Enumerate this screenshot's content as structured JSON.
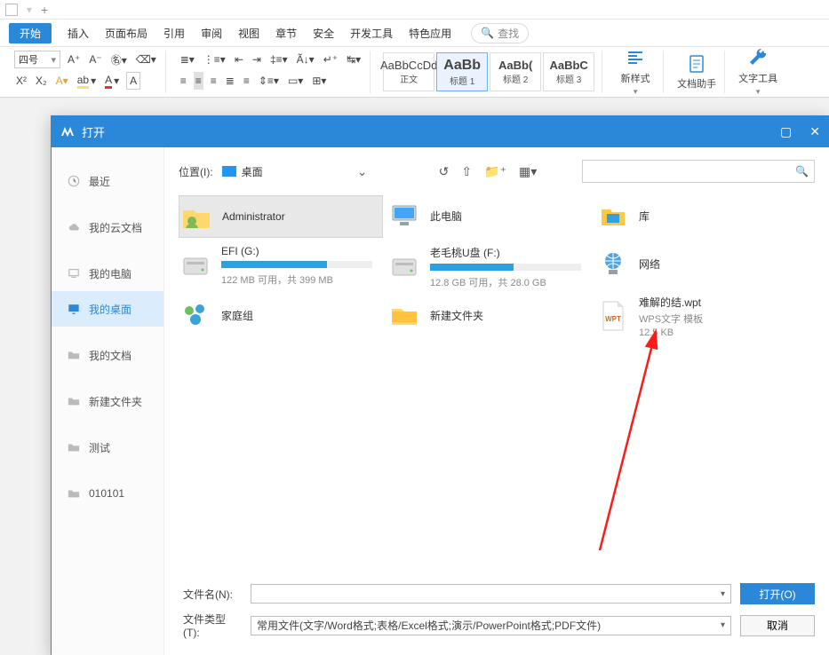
{
  "menu": {
    "start": "开始",
    "items": [
      "插入",
      "页面布局",
      "引用",
      "审阅",
      "视图",
      "章节",
      "安全",
      "开发工具",
      "特色应用"
    ],
    "search_label": "查找"
  },
  "ribbon": {
    "font_size": "四号",
    "styles": [
      {
        "preview": "AaBbCcDd",
        "label": "正文"
      },
      {
        "preview": "AaBb",
        "label": "标题 1"
      },
      {
        "preview": "AaBb(",
        "label": "标题 2"
      },
      {
        "preview": "AaBbC",
        "label": "标题 3"
      }
    ],
    "new_style": "新样式",
    "doc_assistant": "文档助手",
    "text_tools": "文字工具"
  },
  "dialog": {
    "title": "打开",
    "location_label": "位置(I):",
    "location_value": "桌面",
    "sidebar": [
      {
        "label": "最近",
        "icon": "clock"
      },
      {
        "label": "我的云文档",
        "icon": "cloud"
      },
      {
        "label": "我的电脑",
        "icon": "pc"
      },
      {
        "label": "我的桌面",
        "icon": "desktop",
        "active": true
      },
      {
        "label": "我的文档",
        "icon": "folder"
      },
      {
        "label": "新建文件夹",
        "icon": "folder"
      },
      {
        "label": "测试",
        "icon": "folder"
      },
      {
        "label": "010101",
        "icon": "folder"
      }
    ],
    "items": {
      "admin": {
        "name": "Administrator"
      },
      "this_pc": {
        "name": "此电脑"
      },
      "library": {
        "name": "库"
      },
      "efi": {
        "name": "EFI (G:)",
        "sub": "122 MB 可用，共 399 MB",
        "pct": 70
      },
      "udisk": {
        "name": "老毛桃U盘 (F:)",
        "sub": "12.8 GB 可用，共 28.0 GB",
        "pct": 55
      },
      "network": {
        "name": "网络"
      },
      "homegroup": {
        "name": "家庭组"
      },
      "newfolder": {
        "name": "新建文件夹"
      },
      "wpt": {
        "name": "难解的结.wpt",
        "sub1": "WPS文字 模板",
        "sub2": "12.5 KB"
      }
    },
    "filename_label": "文件名(N):",
    "filetype_label": "文件类型(T):",
    "filetype_value": "常用文件(文字/Word格式;表格/Excel格式;演示/PowerPoint格式;PDF文件)",
    "open_btn": "打开(O)",
    "cancel_btn": "取消"
  }
}
